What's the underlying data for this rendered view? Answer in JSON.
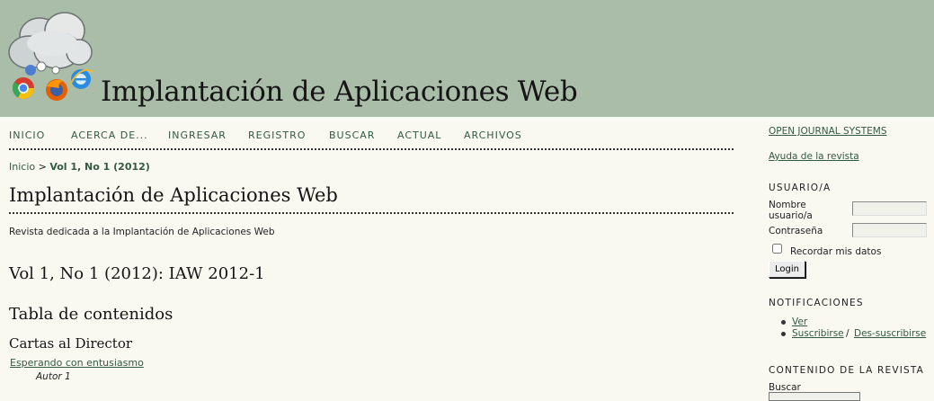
{
  "header": {
    "title": "Implantación de Aplicaciones Web",
    "colors": {
      "header_bg": "#a9bda8",
      "page_bg": "#f9f8f1",
      "link": "#335a40"
    }
  },
  "nav": {
    "items": [
      "INICIO",
      "ACERCA DE...",
      "INGRESAR",
      "REGISTRO",
      "BUSCAR",
      "ACTUAL",
      "ARCHIVOS"
    ]
  },
  "breadcrumb": {
    "home": "Inicio",
    "separator": ">",
    "current": "Vol 1, No 1 (2012)"
  },
  "main": {
    "page_title": "Implantación de Aplicaciones Web",
    "description": "Revista dedicada a la Implantación de Aplicaciones Web",
    "issue_title": "Vol 1, No 1 (2012): IAW 2012-1",
    "toc_title": "Tabla de contenidos",
    "section_title": "Cartas al Director",
    "article": {
      "title": "Esperando con entusiasmo",
      "author": "Autor 1"
    }
  },
  "sidebar": {
    "ojs_link": "OPEN JOURNAL SYSTEMS",
    "help_link": "Ayuda de la revista",
    "user": {
      "heading": "USUARIO/A",
      "username_label": "Nombre usuario/a",
      "password_label": "Contraseña",
      "username_value": "",
      "password_value": "",
      "remember_label": "Recordar mis datos",
      "login_button": "Login"
    },
    "notifications": {
      "heading": "NOTIFICACIONES",
      "view": "Ver",
      "subscribe": "Suscribirse",
      "slash": "/",
      "unsubscribe": "Des-suscribirse"
    },
    "content": {
      "heading": "CONTENIDO DE LA REVISTA",
      "search_label": "Buscar"
    }
  },
  "icons": {
    "logo": [
      "cloud-icon",
      "snowflake-icon",
      "chrome-icon",
      "firefox-icon",
      "internet-explorer-icon"
    ]
  }
}
